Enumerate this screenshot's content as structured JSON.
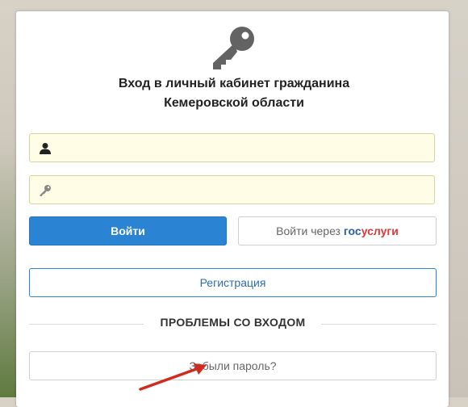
{
  "header": {
    "icon": "key-icon",
    "title_line1": "Вход в личный кабинет гражданина",
    "title_line2": "Кемеровской области"
  },
  "form": {
    "login": {
      "icon": "user-icon",
      "value": "",
      "placeholder": ""
    },
    "password": {
      "icon": "key-small-icon",
      "value": "",
      "placeholder": ""
    }
  },
  "buttons": {
    "login": "Войти",
    "gosuslugi_prefix": "Войти через ",
    "gosuslugi_brand_a": "гос",
    "gosuslugi_brand_b": "услуги",
    "register": "Регистрация",
    "forgot": "Забыли пароль?"
  },
  "problems_heading": "ПРОБЛЕМЫ СО ВХОДОМ",
  "colors": {
    "primary": "#2b84d3",
    "field_bg": "#fffde6",
    "gos_blue": "#2a5fa4",
    "gos_red": "#d73a3a",
    "annotation_arrow": "#d12a1e"
  }
}
